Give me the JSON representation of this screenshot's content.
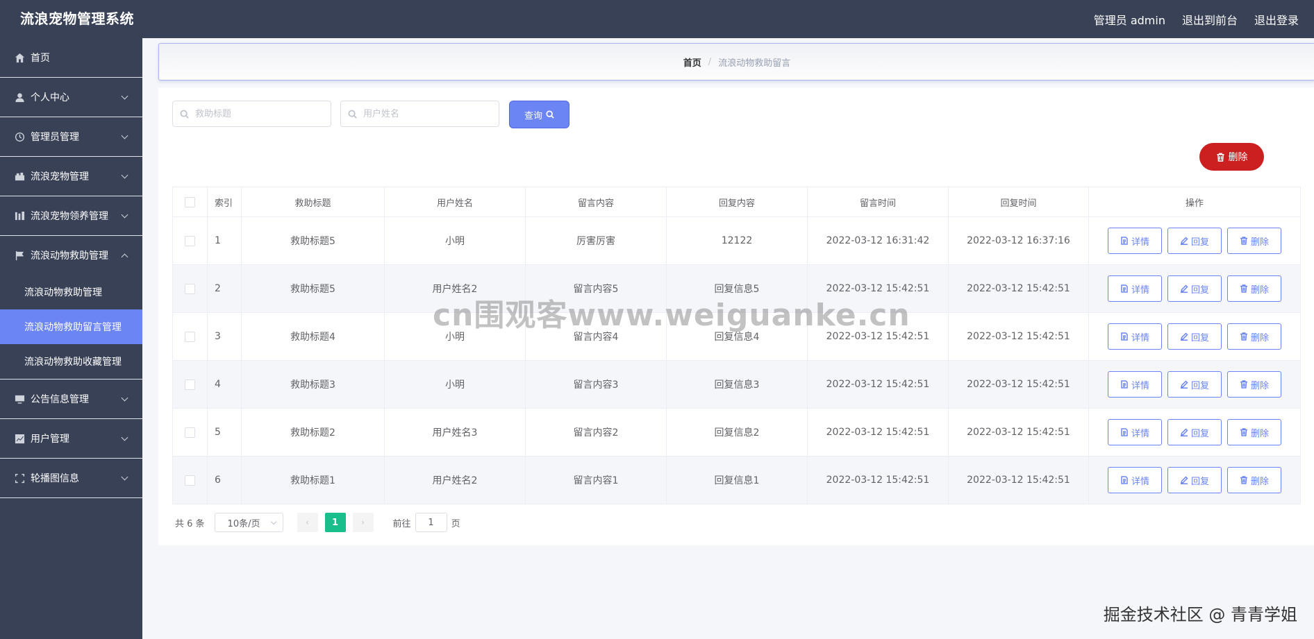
{
  "header": {
    "title": "流浪宠物管理系统",
    "admin_label": "管理员 admin",
    "to_front": "退出到前台",
    "logout": "退出登录"
  },
  "sidebar": {
    "items": [
      {
        "label": "首页",
        "icon": "home-icon"
      },
      {
        "label": "个人中心",
        "icon": "user-icon"
      },
      {
        "label": "管理员管理",
        "icon": "clock-icon"
      },
      {
        "label": "流浪宠物管理",
        "icon": "box-icon"
      },
      {
        "label": "流浪宠物领养管理",
        "icon": "chart-icon"
      },
      {
        "label": "流浪动物救助管理",
        "icon": "flag-icon"
      },
      {
        "label": "公告信息管理",
        "icon": "monitor-icon"
      },
      {
        "label": "用户管理",
        "icon": "trend-icon"
      },
      {
        "label": "轮播图信息",
        "icon": "frame-icon"
      }
    ],
    "subitems": [
      {
        "label": "流浪动物救助管理"
      },
      {
        "label": "流浪动物救助留言管理"
      },
      {
        "label": "流浪动物救助收藏管理"
      }
    ]
  },
  "breadcrumb": {
    "home": "首页",
    "sep": "/",
    "current": "流浪动物救助留言"
  },
  "search": {
    "title_placeholder": "救助标题",
    "user_placeholder": "用户姓名",
    "query_label": "查询"
  },
  "toolbar": {
    "delete_label": "删除"
  },
  "table": {
    "headers": [
      "索引",
      "救助标题",
      "用户姓名",
      "留言内容",
      "回复内容",
      "留言时间",
      "回复时间",
      "操作"
    ],
    "rows": [
      {
        "index": "1",
        "title": "救助标题5",
        "user": "小明",
        "content": "厉害厉害",
        "reply": "12122",
        "msg_time": "2022-03-12 16:31:42",
        "reply_time": "2022-03-12 16:37:16"
      },
      {
        "index": "2",
        "title": "救助标题5",
        "user": "用户姓名2",
        "content": "留言内容5",
        "reply": "回复信息5",
        "msg_time": "2022-03-12 15:42:51",
        "reply_time": "2022-03-12 15:42:51"
      },
      {
        "index": "3",
        "title": "救助标题4",
        "user": "小明",
        "content": "留言内容4",
        "reply": "回复信息4",
        "msg_time": "2022-03-12 15:42:51",
        "reply_time": "2022-03-12 15:42:51"
      },
      {
        "index": "4",
        "title": "救助标题3",
        "user": "小明",
        "content": "留言内容3",
        "reply": "回复信息3",
        "msg_time": "2022-03-12 15:42:51",
        "reply_time": "2022-03-12 15:42:51"
      },
      {
        "index": "5",
        "title": "救助标题2",
        "user": "用户姓名3",
        "content": "留言内容2",
        "reply": "回复信息2",
        "msg_time": "2022-03-12 15:42:51",
        "reply_time": "2022-03-12 15:42:51"
      },
      {
        "index": "6",
        "title": "救助标题1",
        "user": "用户姓名2",
        "content": "留言内容1",
        "reply": "回复信息1",
        "msg_time": "2022-03-12 15:42:51",
        "reply_time": "2022-03-12 15:42:51"
      }
    ],
    "actions": {
      "detail": "详情",
      "reply": "回复",
      "delete": "删除"
    }
  },
  "pagination": {
    "total": "共 6 条",
    "page_size": "10条/页",
    "prev": "‹",
    "current_page": "1",
    "next": "›",
    "goto_prefix": "前往",
    "goto_value": "1",
    "goto_suffix": "页"
  },
  "watermarks": {
    "center": "cn围观客www.weiguanke.cn",
    "corner": "掘金技术社区 @ 青青学姐"
  },
  "colors": {
    "sidebar_bg": "#394157",
    "accent": "#6b85f5",
    "danger": "#cc1f1f",
    "current_page": "#19be8c"
  }
}
